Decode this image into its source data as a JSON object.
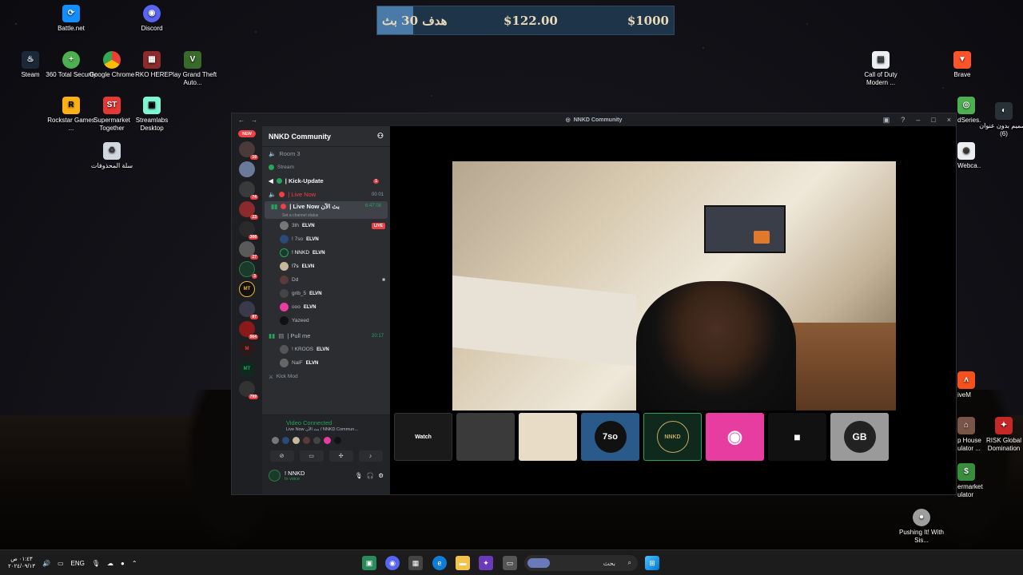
{
  "desktop": {
    "icons_left": [
      {
        "label": "Battle.net",
        "icon": "battlenet-icon",
        "color": "#148eff"
      },
      {
        "label": "Discord",
        "icon": "discord-icon",
        "color": "#5865f2"
      },
      {
        "label": "Steam",
        "icon": "steam-icon",
        "color": "#1b2838"
      },
      {
        "label": "360 Total Security",
        "icon": "shield-icon",
        "color": "#4caf50"
      },
      {
        "label": "Google Chrome",
        "icon": "chrome-icon",
        "color": "#ea4335"
      },
      {
        "label": "RKO HERE",
        "icon": "game-icon",
        "color": "#8b2b2b"
      },
      {
        "label": "Play Grand Theft Auto...",
        "icon": "gta-icon",
        "color": "#3a6a2a"
      },
      {
        "label": "Rockstar Games ...",
        "icon": "rockstar-icon",
        "color": "#fcaf17"
      },
      {
        "label": "Supermarket Together",
        "icon": "store-icon",
        "color": "#e53935"
      },
      {
        "label": "Streamlabs Desktop",
        "icon": "streamlabs-icon",
        "color": "#80f5d2"
      },
      {
        "label": "سلة المحذوفات",
        "icon": "recycle-bin-icon",
        "color": "#cfd8dc"
      }
    ],
    "icons_right": [
      {
        "label": "Call of Duty Modern ...",
        "icon": "file-icon"
      },
      {
        "label": "Brave",
        "icon": "brave-icon"
      },
      {
        "label": "تصميم بدون عنوان (6)",
        "icon": "image-icon"
      },
      {
        "label": "dSeries...",
        "icon": "app-icon"
      },
      {
        "label": "Webca...",
        "icon": "webcam-icon"
      },
      {
        "label": "iveM",
        "icon": "fivem-icon"
      },
      {
        "label": "p House ulator ...",
        "icon": "house-icon"
      },
      {
        "label": "RISK Global Domination",
        "icon": "risk-icon"
      },
      {
        "label": "ermarket ulator",
        "icon": "store-icon"
      },
      {
        "label": "Pushing It! With Sis...",
        "icon": "game-icon"
      }
    ]
  },
  "goal_bar": {
    "goal_label": "هدف 30 بث",
    "current": "$122.00",
    "target": "$1000"
  },
  "discord": {
    "window_title": "NNKD Community",
    "guild_name": "NNKD Community",
    "channels": [
      {
        "name": "Room 3",
        "type": "voice"
      },
      {
        "name": "Stream",
        "type": "category"
      },
      {
        "name": "| Kick-Update",
        "type": "text",
        "badge": "1"
      },
      {
        "name": "| Live Now",
        "type": "voice",
        "counter": "00  01"
      },
      {
        "name": "| Live Now بث الآن",
        "type": "voice-active",
        "timer": "6:47:08",
        "status": "Set a channel status"
      }
    ],
    "voice_users": [
      {
        "name": "3th",
        "tag": "ELVN",
        "live": "LIVE"
      },
      {
        "name": "! 7so",
        "tag": "ELVN"
      },
      {
        "name": "! NNKD",
        "tag": "ELVN"
      },
      {
        "name": "!7s",
        "tag": "ELVN"
      },
      {
        "name": "Dd",
        "tag": ""
      },
      {
        "name": "grib_5",
        "tag": "ELVN"
      },
      {
        "name": "ooo",
        "tag": "ELVN"
      },
      {
        "name": "Yazeed",
        "tag": ""
      }
    ],
    "pullme_channel": {
      "name": "| Pull me",
      "timer": "20:17"
    },
    "pullme_users": [
      {
        "name": "! KROOS",
        "tag": "ELVN"
      },
      {
        "name": "NaiF",
        "tag": "ELVN"
      }
    ],
    "kick_mod": "Kick Mod",
    "voice_connected": "Video Connected",
    "voice_location": "Live Now بث الآن / NNKD Commun...",
    "me_name": "! NNKD",
    "me_status": "In voice",
    "server_badges": [
      "19",
      "74",
      "23",
      "308",
      "27",
      "3",
      "87",
      "564",
      "799"
    ],
    "new_label": "NEW",
    "tiles": [
      {
        "label": "Watch",
        "color": "#1a1a1a"
      },
      {
        "label": "",
        "color": "#3a3a3a"
      },
      {
        "label": "",
        "color": "#e8dcc6"
      },
      {
        "label": "7so",
        "color": "#2a5a8a"
      },
      {
        "label": "NNKD",
        "color": "#0f2a1c"
      },
      {
        "label": "",
        "color": "#e83da0"
      },
      {
        "label": "",
        "color": "#111111"
      },
      {
        "label": "GB",
        "color": "#9a9a9a"
      }
    ]
  },
  "taskbar": {
    "time": "٠١:٤٣ ص",
    "date": "٢٠٢٤/٠٩/١٣",
    "lang": "ENG",
    "search_placeholder": "بحث"
  }
}
